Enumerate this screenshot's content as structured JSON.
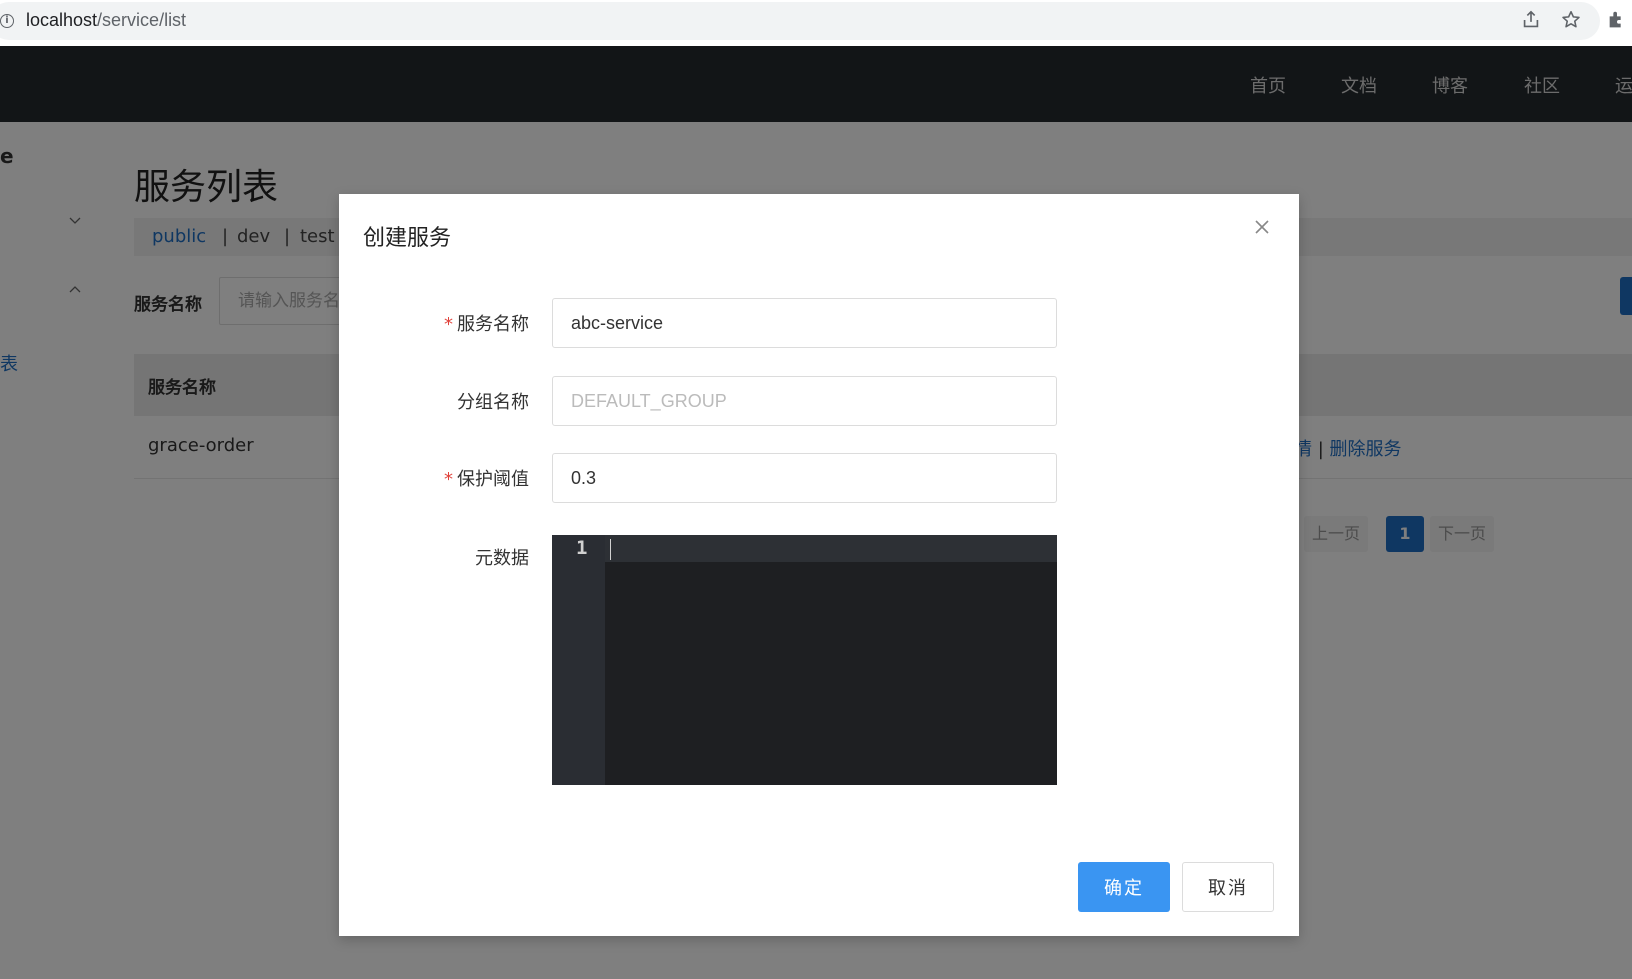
{
  "browser": {
    "url_host": "localhost",
    "url_path": "/service/list"
  },
  "nav": {
    "items": [
      "首页",
      "文档",
      "博客",
      "社区",
      "运"
    ]
  },
  "sidebar": {
    "partial_title": "e",
    "partial_link": "表"
  },
  "page": {
    "title": "服务列表",
    "namespaces": [
      "public",
      "dev",
      "test"
    ],
    "filter_label": "服务名称",
    "filter_placeholder": "请输入服务名",
    "table_header_name": "服务名称",
    "rows": [
      {
        "name": "grace-order",
        "op_detail": "情",
        "op_sep": "|",
        "op_delete": "删除服务"
      }
    ],
    "pager": {
      "prev": "上一页",
      "current": "1",
      "next": "下一页"
    }
  },
  "dialog": {
    "title": "创建服务",
    "required_mark": "*",
    "fields": {
      "service_name": {
        "label": "服务名称",
        "value": "abc-service"
      },
      "group_name": {
        "label": "分组名称",
        "placeholder": "DEFAULT_GROUP"
      },
      "protect_threshold": {
        "label": "保护阈值",
        "value": "0.3"
      },
      "metadata": {
        "label": "元数据",
        "line_number": "1"
      }
    },
    "confirm_label": "确定",
    "cancel_label": "取消"
  },
  "colors": {
    "header_bg": "#252a2f",
    "primary": "#3a95f2",
    "link": "#1f6fc5",
    "editor_bg": "#1e1f22"
  }
}
